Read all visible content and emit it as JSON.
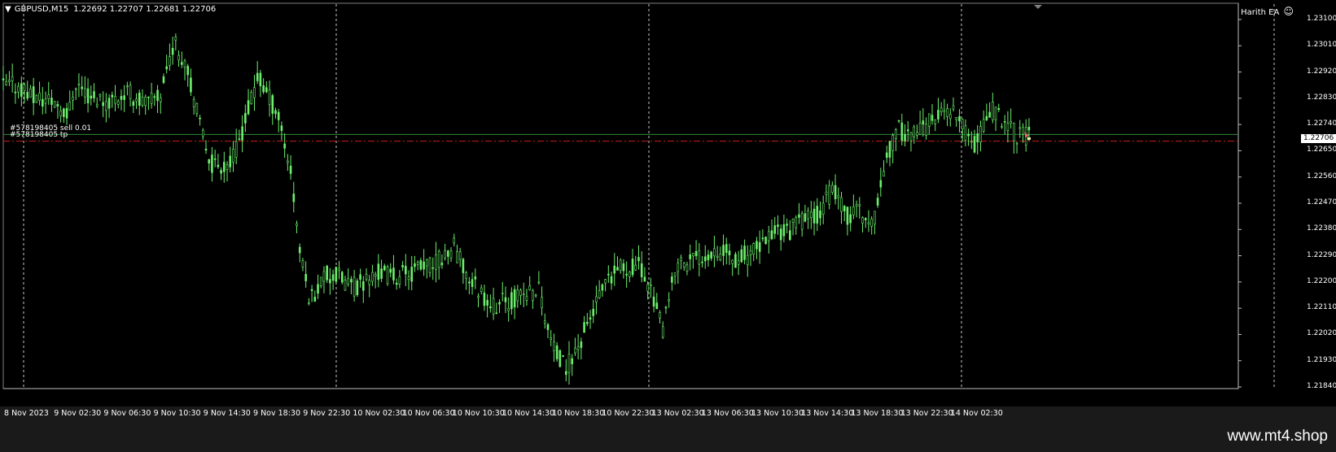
{
  "header": {
    "symbol": "GBPUSD,M15",
    "ohlc": "1.22692 1.22707 1.22681 1.22706",
    "expert_name": "Harith EA",
    "expert_icon": "smiley-icon"
  },
  "orders": [
    {
      "label": "#578198405 sell 0.01",
      "price": 1.22706,
      "color": "#2e8b3a",
      "style": "solid"
    },
    {
      "label": "#578198405 tp",
      "price": 1.22683,
      "color": "#c81e1e",
      "style": "dash-dot"
    }
  ],
  "current_price_label": "1.22706",
  "price_axis": {
    "ticks": [
      "1.23100",
      "1.23010",
      "1.22920",
      "1.22830",
      "1.22740",
      "1.22650",
      "1.22560",
      "1.22470",
      "1.22380",
      "1.22290",
      "1.22200",
      "1.22110",
      "1.22020",
      "1.21930",
      "1.21840"
    ]
  },
  "time_axis": {
    "labels": [
      "8 Nov 2023",
      "9 Nov 02:30",
      "9 Nov 06:30",
      "9 Nov 10:30",
      "9 Nov 14:30",
      "9 Nov 18:30",
      "9 Nov 22:30",
      "10 Nov 02:30",
      "10 Nov 06:30",
      "10 Nov 10:30",
      "10 Nov 14:30",
      "10 Nov 18:30",
      "10 Nov 22:30",
      "13 Nov 02:30",
      "13 Nov 06:30",
      "13 Nov 10:30",
      "13 Nov 14:30",
      "13 Nov 18:30",
      "13 Nov 22:30",
      "14 Nov 02:30"
    ]
  },
  "day_separators": [
    "9 Nov",
    "10 Nov",
    "13 Nov",
    "14 Nov",
    "14 Nov"
  ],
  "colors": {
    "background": "#000000",
    "candle": "#6cf06c",
    "grid": "#c8c8c8",
    "axis_text": "#ffffff"
  },
  "price_path": [
    [
      0,
      1.2287
    ],
    [
      0.012,
      1.22875
    ],
    [
      0.025,
      1.2283
    ],
    [
      0.04,
      1.2282
    ],
    [
      0.05,
      1.2277
    ],
    [
      0.055,
      1.2289
    ],
    [
      0.065,
      1.2284
    ],
    [
      0.08,
      1.2282
    ],
    [
      0.095,
      1.2285
    ],
    [
      0.11,
      1.2281
    ],
    [
      0.12,
      1.2284
    ],
    [
      0.13,
      1.2302
    ],
    [
      0.14,
      1.2296
    ],
    [
      0.15,
      1.2274
    ],
    [
      0.16,
      1.226
    ],
    [
      0.175,
      1.2261
    ],
    [
      0.185,
      1.2275
    ],
    [
      0.195,
      1.229
    ],
    [
      0.21,
      1.2278
    ],
    [
      0.22,
      1.2258
    ],
    [
      0.228,
      1.2227
    ],
    [
      0.235,
      1.2214
    ],
    [
      0.245,
      1.2222
    ],
    [
      0.255,
      1.2222
    ],
    [
      0.27,
      1.2218
    ],
    [
      0.285,
      1.2223
    ],
    [
      0.3,
      1.2222
    ],
    [
      0.315,
      1.2224
    ],
    [
      0.33,
      1.2226
    ],
    [
      0.345,
      1.2232
    ],
    [
      0.355,
      1.2222
    ],
    [
      0.365,
      1.2217
    ],
    [
      0.375,
      1.2212
    ],
    [
      0.39,
      1.2214
    ],
    [
      0.41,
      1.2218
    ],
    [
      0.42,
      1.2198
    ],
    [
      0.43,
      1.219
    ],
    [
      0.44,
      1.2198
    ],
    [
      0.455,
      1.2214
    ],
    [
      0.47,
      1.2224
    ],
    [
      0.485,
      1.2226
    ],
    [
      0.495,
      1.2219
    ],
    [
      0.505,
      1.2203
    ],
    [
      0.515,
      1.2226
    ],
    [
      0.53,
      1.2228
    ],
    [
      0.545,
      1.2232
    ],
    [
      0.56,
      1.2228
    ],
    [
      0.575,
      1.223
    ],
    [
      0.59,
      1.2238
    ],
    [
      0.6,
      1.2237
    ],
    [
      0.61,
      1.2241
    ],
    [
      0.625,
      1.2244
    ],
    [
      0.635,
      1.2252
    ],
    [
      0.645,
      1.2242
    ],
    [
      0.655,
      1.2245
    ],
    [
      0.665,
      1.2238
    ],
    [
      0.675,
      1.2262
    ],
    [
      0.685,
      1.2272
    ],
    [
      0.7,
      1.2271
    ],
    [
      0.715,
      1.2277
    ],
    [
      0.725,
      1.2279
    ],
    [
      0.735,
      1.2272
    ],
    [
      0.745,
      1.2267
    ],
    [
      0.755,
      1.2279
    ],
    [
      0.765,
      1.2276
    ],
    [
      0.775,
      1.2271
    ],
    [
      0.785,
      1.227
    ]
  ]
}
